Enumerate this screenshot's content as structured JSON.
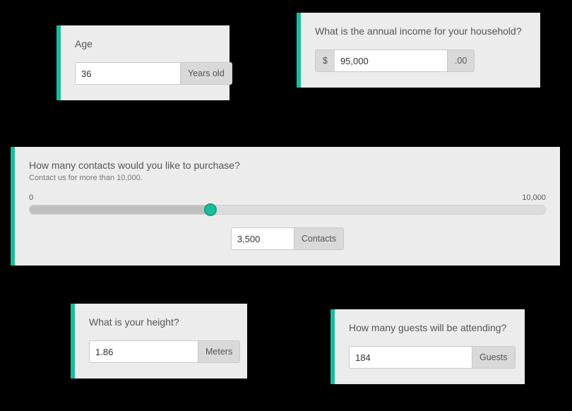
{
  "age": {
    "title": "Age",
    "value": "36",
    "unit": "Years old"
  },
  "income": {
    "title": "What is the annual income for your household?",
    "currency": "$",
    "value": "95,000",
    "decimals": ".00"
  },
  "contacts": {
    "title": "How many contacts would you like to purchase?",
    "subtitle": "Contact us for more than 10,000.",
    "min_label": "0",
    "max_label": "10,000",
    "value": "3,500",
    "unit": "Contacts"
  },
  "height": {
    "title": "What is your height?",
    "value": "1.86",
    "unit": "Meters"
  },
  "guests": {
    "title": "How many guests will be attending?",
    "value": "184",
    "unit": "Guests"
  }
}
